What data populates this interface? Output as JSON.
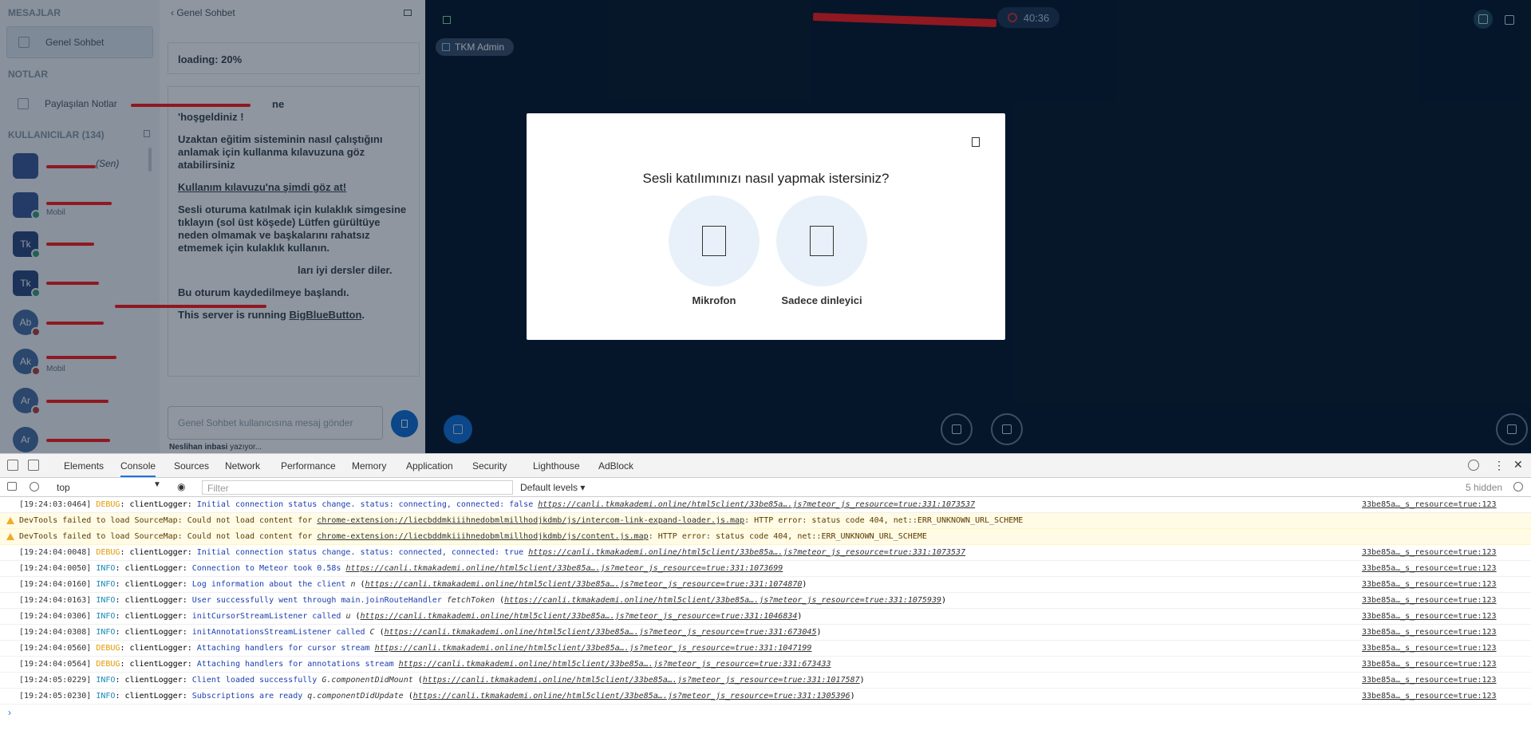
{
  "sidebar": {
    "messages_header": "MESAJLAR",
    "public_chat": "Genel Sohbet",
    "notes_header": "NOTLAR",
    "shared_notes": "Paylaşılan Notlar",
    "users_header": "KULLANICILAR (134)",
    "users": [
      {
        "initials": "",
        "sub": "",
        "you": "(Sen)"
      },
      {
        "initials": "",
        "sub": "Mobil",
        "you": ""
      },
      {
        "initials": "Tk",
        "sub": "",
        "you": ""
      },
      {
        "initials": "Tk",
        "sub": "",
        "you": ""
      },
      {
        "initials": "Ab",
        "sub": "",
        "you": ""
      },
      {
        "initials": "Ak",
        "sub": "Mobil",
        "you": ""
      },
      {
        "initials": "Ar",
        "sub": "",
        "you": ""
      },
      {
        "initials": "Ar",
        "sub": "",
        "you": ""
      }
    ]
  },
  "chat": {
    "title": "Genel Sohbet",
    "loading": "loading: 20%",
    "welcome_line1": "ne",
    "welcome_line2": "'hoşgeldiniz !",
    "guide_text": "Uzaktan eğitim sisteminin nasıl çalıştığını anlamak için kullanma kılavuzuna göz atabilirsiniz",
    "guide_link": "Kullanım kılavuzu'na şimdi göz at!",
    "audio_tip": "Sesli oturuma katılmak için kulaklık simgesine tıklayın (sol üst köşede) Lütfen gürültüye neden olmamak ve başkalarını rahatsız etmemek için kulaklık kullanın.",
    "lesson_wish": "ları iyi dersler diler.",
    "recording": "Bu oturum kaydedilmeye başlandı.",
    "server_prefix": "This server is running ",
    "server_link": "BigBlueButton",
    "input_placeholder": "Genel Sohbet kullanıcısına mesaj gönder",
    "typing_name": "Neslihan",
    "typing_text": "inbasi",
    "typing_suffix": "yazıyor..."
  },
  "main": {
    "host_badge": "TKM Admin",
    "timer": "40:36"
  },
  "modal": {
    "question": "Sesli katılımınızı nasıl yapmak istersiniz?",
    "option_mic": "Mikrofon",
    "option_listen": "Sadece dinleyici"
  },
  "devtools": {
    "tabs": [
      "Elements",
      "Console",
      "Sources",
      "Network",
      "Performance",
      "Memory",
      "Application",
      "Security",
      "Lighthouse",
      "AdBlock"
    ],
    "active_tab": "Console",
    "context": "top",
    "filter_placeholder": "Filter",
    "levels": "Default levels ▾",
    "hidden": "5 hidden",
    "rows": [
      {
        "type": "log",
        "ts": "[19:24:03:0464]",
        "level": "DEBUG",
        "logger": ": clientLogger: ",
        "msg": "Initial connection status change. status: connecting, connected: false",
        "fn": "",
        "url": "https://canli.tkmakademi.online/html5client/33be85a….js?meteor_js_resource=true:331:1073537",
        "paren": false,
        "src": "33be85a…_s_resource=true:123"
      },
      {
        "type": "warn",
        "text": "DevTools failed to load SourceMap: Could not load content for ",
        "url": "chrome-extension://liecbddmkiiihnedobmlmillhodjkdmb/js/intercom-link-expand-loader.js.map",
        "tail": ": HTTP error: status code 404, net::ERR_UNKNOWN_URL_SCHEME"
      },
      {
        "type": "warn",
        "text": "DevTools failed to load SourceMap: Could not load content for ",
        "url": "chrome-extension://liecbddmkiiihnedobmlmillhodjkdmb/js/content.js.map",
        "tail": ": HTTP error: status code 404, net::ERR_UNKNOWN_URL_SCHEME"
      },
      {
        "type": "log",
        "ts": "[19:24:04:0048]",
        "level": "DEBUG",
        "logger": ": clientLogger: ",
        "msg": "Initial connection status change. status: connected, connected: true",
        "fn": "",
        "url": "https://canli.tkmakademi.online/html5client/33be85a….js?meteor_js_resource=true:331:1073537",
        "paren": false,
        "src": "33be85a…_s_resource=true:123"
      },
      {
        "type": "log",
        "ts": "[19:24:04:0050]",
        "level": "INFO",
        "logger": ": clientLogger: ",
        "msg": "Connection to Meteor took 0.58s",
        "fn": "",
        "url": "https://canli.tkmakademi.online/html5client/33be85a….js?meteor_js_resource=true:331:1073699",
        "paren": false,
        "src": "33be85a…_s_resource=true:123"
      },
      {
        "type": "log",
        "ts": "[19:24:04:0160]",
        "level": "INFO",
        "logger": ": clientLogger: ",
        "msg": "Log information about the client",
        "fn": "n",
        "url": "https://canli.tkmakademi.online/html5client/33be85a….js?meteor_js_resource=true:331:1074870",
        "paren": true,
        "src": "33be85a…_s_resource=true:123"
      },
      {
        "type": "log",
        "ts": "[19:24:04:0163]",
        "level": "INFO",
        "logger": ": clientLogger: ",
        "msg": "User successfully went through main.joinRouteHandler",
        "fn": "fetchToken",
        "url": "https://canli.tkmakademi.online/html5client/33be85a….js?meteor_js_resource=true:331:1075939",
        "paren": true,
        "src": "33be85a…_s_resource=true:123"
      },
      {
        "type": "log",
        "ts": "[19:24:04:0306]",
        "level": "INFO",
        "logger": ": clientLogger: ",
        "msg": "initCursorStreamListener called",
        "fn": "u",
        "url": "https://canli.tkmakademi.online/html5client/33be85a….js?meteor_js_resource=true:331:1046834",
        "paren": true,
        "src": "33be85a…_s_resource=true:123"
      },
      {
        "type": "log",
        "ts": "[19:24:04:0308]",
        "level": "INFO",
        "logger": ": clientLogger: ",
        "msg": "initAnnotationsStreamListener called",
        "fn": "C",
        "url": "https://canli.tkmakademi.online/html5client/33be85a….js?meteor_js_resource=true:331:673045",
        "paren": true,
        "src": "33be85a…_s_resource=true:123"
      },
      {
        "type": "log",
        "ts": "[19:24:04:0560]",
        "level": "DEBUG",
        "logger": ": clientLogger: ",
        "msg": "Attaching handlers for cursor stream",
        "fn": "",
        "url": "https://canli.tkmakademi.online/html5client/33be85a….js?meteor_js_resource=true:331:1047199",
        "paren": false,
        "src": "33be85a…_s_resource=true:123"
      },
      {
        "type": "log",
        "ts": "[19:24:04:0564]",
        "level": "DEBUG",
        "logger": ": clientLogger: ",
        "msg": "Attaching handlers for annotations stream",
        "fn": "",
        "url": "https://canli.tkmakademi.online/html5client/33be85a….js?meteor_js_resource=true:331:673433",
        "paren": false,
        "src": "33be85a…_s_resource=true:123"
      },
      {
        "type": "log",
        "ts": "[19:24:05:0229]",
        "level": "INFO",
        "logger": ": clientLogger: ",
        "msg": "Client loaded successfully",
        "fn": "G.componentDidMount",
        "url": "https://canli.tkmakademi.online/html5client/33be85a….js?meteor_js_resource=true:331:1017587",
        "paren": true,
        "src": "33be85a…_s_resource=true:123"
      },
      {
        "type": "log",
        "ts": "[19:24:05:0230]",
        "level": "INFO",
        "logger": ": clientLogger: ",
        "msg": "Subscriptions are ready",
        "fn": "q.componentDidUpdate",
        "url": "https://canli.tkmakademi.online/html5client/33be85a….js?meteor_js_resource=true:331:1305396",
        "paren": true,
        "src": "33be85a…_s_resource=true:123"
      }
    ],
    "prompt": "›"
  }
}
